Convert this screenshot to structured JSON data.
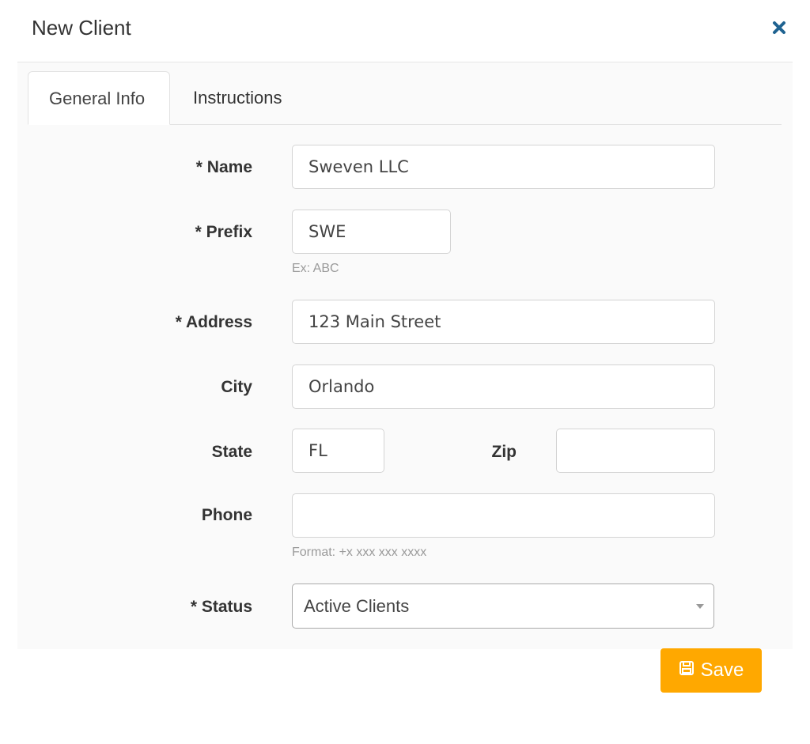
{
  "modal": {
    "title": "New Client",
    "close_icon": "close-icon"
  },
  "tabs": [
    {
      "label": "General Info",
      "active": true
    },
    {
      "label": "Instructions",
      "active": false
    }
  ],
  "form": {
    "name": {
      "label": "* Name",
      "value": "Sweven LLC"
    },
    "prefix": {
      "label": "* Prefix",
      "value": "SWE",
      "help": "Ex: ABC"
    },
    "address": {
      "label": "* Address",
      "value": "123 Main Street"
    },
    "city": {
      "label": "City",
      "value": "Orlando"
    },
    "state": {
      "label": "State",
      "value": "FL"
    },
    "zip": {
      "label": "Zip",
      "value": ""
    },
    "phone": {
      "label": "Phone",
      "value": "",
      "help": "Format: +x xxx xxx xxxx"
    },
    "status": {
      "label": "* Status",
      "selected": "Active Clients"
    }
  },
  "save_button": {
    "label": "Save",
    "icon": "floppy-disk-icon",
    "color": "#ffa800"
  },
  "colors": {
    "accent": "#ffa800",
    "close": "#1f6391"
  }
}
